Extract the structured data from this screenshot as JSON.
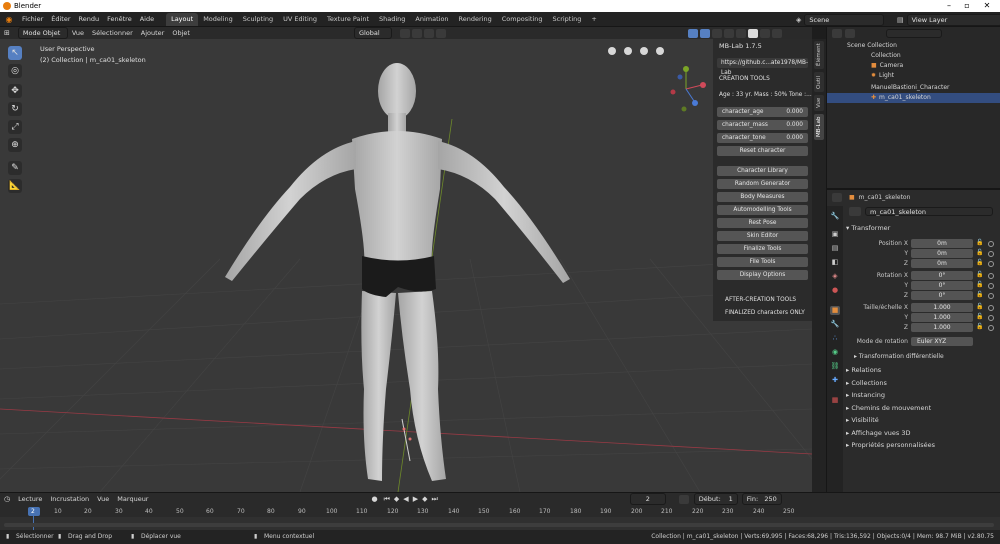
{
  "window": {
    "title": "Blender"
  },
  "menu": [
    "Fichier",
    "Éditer",
    "Rendu",
    "Fenêtre",
    "Aide"
  ],
  "workspaces": [
    {
      "label": "Layout",
      "active": true
    },
    {
      "label": "Modeling"
    },
    {
      "label": "Sculpting"
    },
    {
      "label": "UV Editing"
    },
    {
      "label": "Texture Paint"
    },
    {
      "label": "Shading"
    },
    {
      "label": "Animation"
    },
    {
      "label": "Rendering"
    },
    {
      "label": "Compositing"
    },
    {
      "label": "Scripting"
    }
  ],
  "workspace_add": "+",
  "scene": "Scene",
  "view_layer": "View Layer",
  "viewport_header": {
    "mode": "Mode Objet",
    "menus": [
      "Vue",
      "Sélectionner",
      "Ajouter",
      "Objet"
    ],
    "orientation": "Global"
  },
  "viewport": {
    "perspective": "User Perspective",
    "collection_info": "(2) Collection | m_ca01_skeleton"
  },
  "mblab": {
    "title": "MB-Lab 1.7.5",
    "url": "https://github.c...ate1978/MB-Lab",
    "creation_tools": "CREATION TOOLS",
    "age_line": "Age : 33 yr.  Mass : 50%  Tone :...",
    "fields": [
      {
        "key": "character_age",
        "value": "0.000"
      },
      {
        "key": "character_mass",
        "value": "0.000"
      },
      {
        "key": "character_tone",
        "value": "0.000"
      }
    ],
    "reset": "Reset character",
    "buttons": [
      "Character Library",
      "Random Generator",
      "Body Measures",
      "Automodelling Tools",
      "Rest Pose",
      "Skin Editor",
      "Finalize Tools",
      "File Tools",
      "Display Options"
    ],
    "after_creation": "AFTER-CREATION TOOLS",
    "finalized": "FINALIZED characters ONLY"
  },
  "side_tabs": [
    {
      "label": "Élément"
    },
    {
      "label": "Outil"
    },
    {
      "label": "Vue"
    },
    {
      "label": "MB-Lab",
      "active": true
    }
  ],
  "outliner": {
    "rows": [
      {
        "label": "Scene Collection",
        "indent": 0
      },
      {
        "label": "Collection",
        "indent": 1
      },
      {
        "label": "Camera",
        "indent": 2
      },
      {
        "label": "Light",
        "indent": 2
      },
      {
        "label": "ManuelBastioni_Character",
        "indent": 1
      },
      {
        "label": "m_ca01_skeleton",
        "indent": 2
      }
    ]
  },
  "properties": {
    "header_object": "m_ca01_skeleton",
    "object_name": "m_ca01_skeleton",
    "transform_title": "Transformer",
    "position_label": "Position X",
    "rotation_label": "Rotation X",
    "scale_label": "Taille/échelle X",
    "axis_y": "Y",
    "axis_z": "Z",
    "position": [
      "0m",
      "0m",
      "0m"
    ],
    "rotation": [
      "0°",
      "0°",
      "0°"
    ],
    "scale": [
      "1.000",
      "1.000",
      "1.000"
    ],
    "rotation_mode_label": "Mode de rotation",
    "rotation_mode": "Euler XYZ",
    "delta": "Transformation différentielle",
    "sections": [
      "Relations",
      "Collections",
      "Instancing",
      "Chemins de mouvement",
      "Visibilité",
      "Affichage vues 3D",
      "Propriétés personnalisées"
    ]
  },
  "timeline": {
    "menus": [
      "Lecture",
      "Incrustation",
      "Vue",
      "Marqueur"
    ],
    "current_frame": "2",
    "start_label": "Début:",
    "start": "1",
    "end_label": "Fin:",
    "end": "250",
    "ticks": [
      "2",
      "10",
      "20",
      "30",
      "40",
      "50",
      "60",
      "70",
      "80",
      "90",
      "100",
      "110",
      "120",
      "130",
      "140",
      "150",
      "160",
      "170",
      "180",
      "190",
      "200",
      "210",
      "220",
      "230",
      "240",
      "250"
    ]
  },
  "status": {
    "select": "Sélectionner",
    "drag": "Drag and Drop",
    "move": "Déplacer vue",
    "context": "Menu contextuel",
    "info": "Collection | m_ca01_skeleton | Verts:69,995 | Faces:68,296 | Tris:136,592 | Objects:0/4 | Mem: 98.7 MiB | v2.80.75"
  }
}
